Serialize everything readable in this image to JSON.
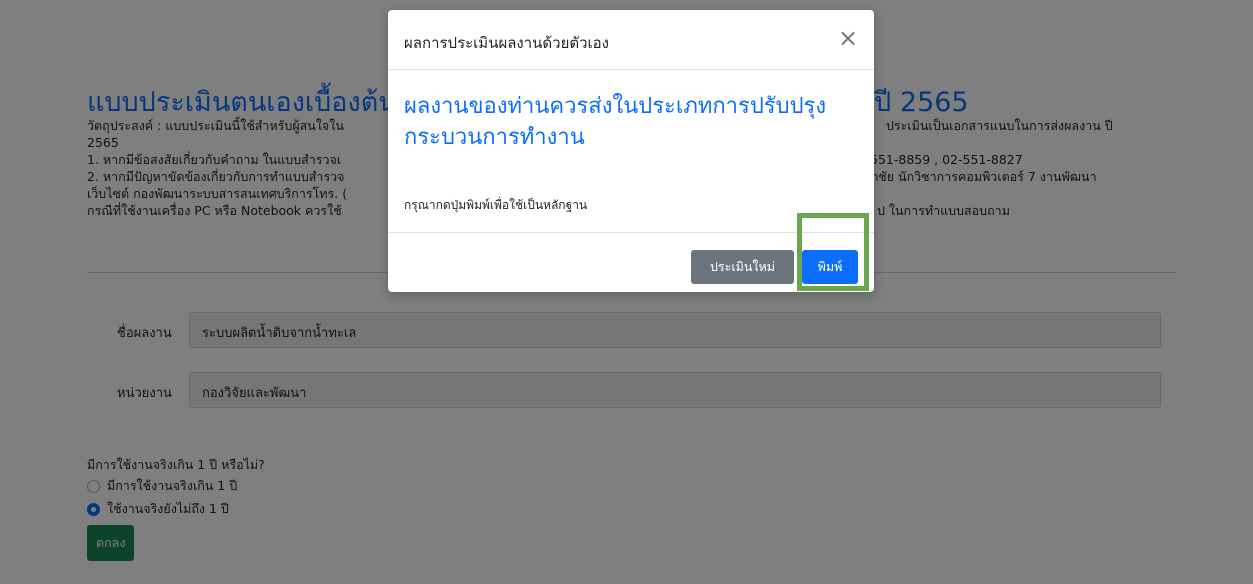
{
  "page": {
    "title_left": "แบบประเมินตนเองเบื้องต้น",
    "title_right": ". ปี 2565",
    "desc_line1": "วัตถุประสงค์ : แบบประเมินนี้ใช้สำหรับผู้สนใจใน",
    "desc_line1_right": "ประเมินเป็นเอกสารแนบในการส่งผลงาน ปี",
    "desc_line2": "2565",
    "desc_line3": "1. หากมีข้อสงสัยเกี่ยวกับคำถาม ในแบบสำรวจเ",
    "desc_line3_right": "551-8859 , 02-551-8827",
    "desc_line4": "2. หากมีปัญหาขัดข้องเกี่ยวกับการทำแบบสำรวจ",
    "desc_line4_right": "ภชัย นักวิชาการคอมพิวเตอร์ 7 งานพัฒนา",
    "desc_line5": "เว็บไซต์ กองพัฒนาระบบสารสนเทศบริการโทร. (",
    "desc_line6": " กรณีที่ใช้งานเครื่อง PC หรือ Notebook ควรใช้",
    "desc_line6_right": "ป ในการทำแบบสอบถาม"
  },
  "form": {
    "work_name_label": "ชื่อผลงาน",
    "work_name_value": "ระบบผลิตน้ำดิบจากน้ำทะเล",
    "agency_label": "หน่วยงาน",
    "agency_value": "กองวิจัยและพัฒนา",
    "question": "มีการใช้งานจริงเกิน 1 ปี หรือไม่?",
    "option_yes": "มีการใช้งานจริงเกิน 1 ปี",
    "option_no": "ใช้งานจริงยังไม่ถึง 1 ปี",
    "selected": "option_no",
    "ok_label": "ตกลง"
  },
  "modal": {
    "title": "ผลการประเมินผลงานด้วยตัวเอง",
    "close_glyph": "×",
    "result": "ผลงานของท่านควรส่งในประเภทการปรับปรุงกระบวนการทำงาน",
    "note": "กรุณากดปุ่มพิมพ์เพื่อใช้เป็นหลักฐาน",
    "reset_label": "ประเมินใหม่",
    "print_label": "พิมพ์"
  },
  "colors": {
    "primary": "#0d6efd",
    "secondary": "#6c757d",
    "success": "#198754",
    "highlight": "#6aa84f"
  }
}
